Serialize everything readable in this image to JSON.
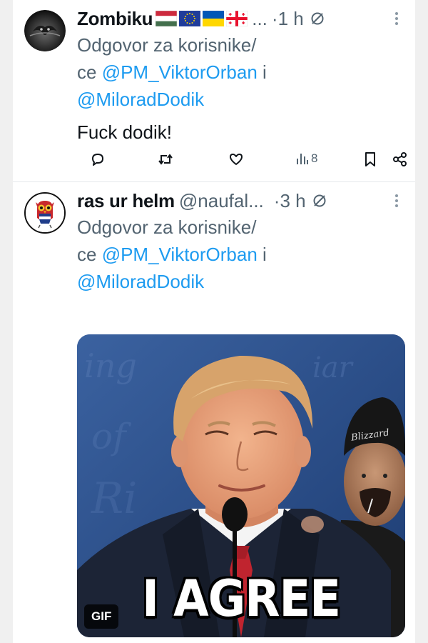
{
  "tweets": [
    {
      "name": "Zombiku",
      "handle_truncated": "...",
      "time": "·1 h",
      "reply_prefix": "Odgovor za korisnike/ce",
      "mention1": "@PM_ViktorOrban",
      "joiner": "i",
      "mention2": "@MiloradDodik",
      "body": "Fuck dodik!",
      "views": "8",
      "flags": [
        "hungary-flag",
        "eu-flag",
        "ukraine-flag",
        "georgia-flag"
      ]
    },
    {
      "name": "ras ur helm",
      "handle": "@naufal...",
      "time": "·3 h",
      "reply_prefix": "Odgovor za korisnike/ce",
      "mention1": "@PM_ViktorOrban",
      "joiner": "i",
      "mention2": "@MiloradDodik",
      "media": {
        "badge": "GIF",
        "caption": "I AGREE",
        "beanie_text": "Blizzard"
      }
    }
  ],
  "colors": {
    "text": "#0f1419",
    "secondary": "#536471",
    "link": "#1d9bf0",
    "divider": "#e6e9eb"
  },
  "icons": [
    "muted-icon",
    "more-icon",
    "reply-icon",
    "retweet-icon",
    "like-icon",
    "views-icon",
    "bookmark-icon",
    "share-icon"
  ]
}
